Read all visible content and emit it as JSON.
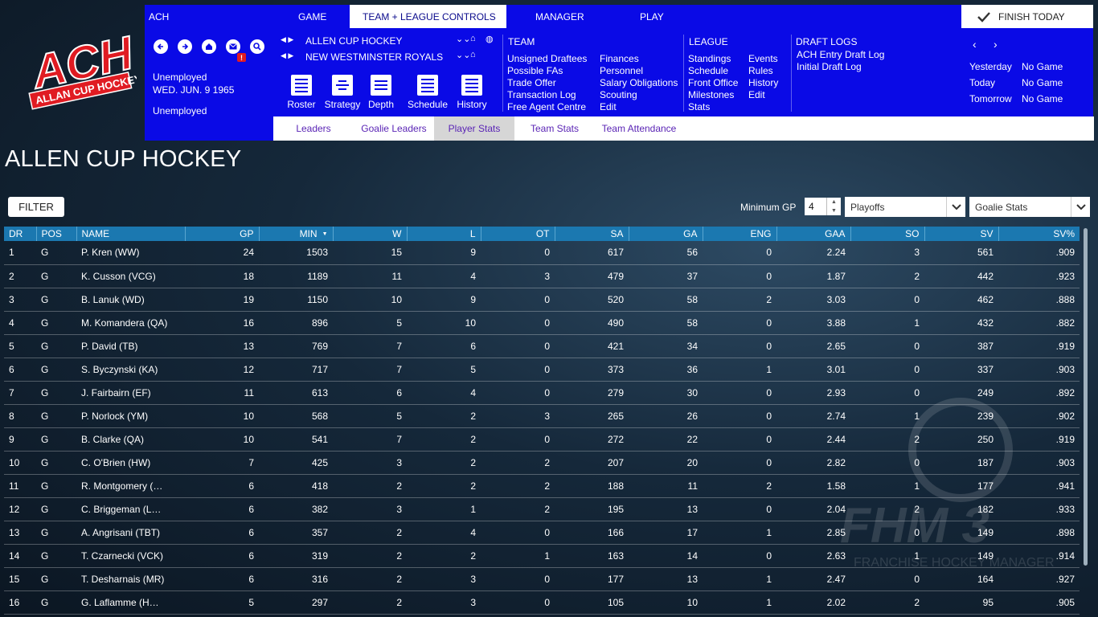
{
  "logo": {
    "main": "ACH",
    "sub": "ALLAN CUP HOCKEY"
  },
  "topnav": {
    "league_abbr": "ACH",
    "tabs": [
      "GAME",
      "TEAM + LEAGUE CONTROLS",
      "MANAGER",
      "PLAY"
    ],
    "finish": "FINISH TODAY"
  },
  "panel": {
    "status1": "Unemployed",
    "date": "WED. JUN. 9 1965",
    "status2": "Unemployed",
    "league_name": "ALLEN CUP HOCKEY",
    "team_name": "NEW WESTMINSTER ROYALS",
    "tools": [
      "Roster",
      "Strategy",
      "Depth",
      "Schedule",
      "History"
    ],
    "team_header": "TEAM",
    "team_col1": [
      "Unsigned Draftees",
      "Possible FAs",
      "Trade Offer",
      "Transaction Log",
      "Free Agent Centre"
    ],
    "team_col2": [
      "Finances",
      "Personnel",
      "Salary Obligations",
      "Scouting",
      "Edit"
    ],
    "league_header": "LEAGUE",
    "league_col1": [
      "Standings",
      "Schedule",
      "Front Office",
      "Milestones",
      "Stats"
    ],
    "league_col2": [
      "Events",
      "Rules",
      "History",
      "Edit"
    ],
    "draft_header": "DRAFT LOGS",
    "draft_links": [
      "ACH Entry Draft Log",
      "Initial Draft Log"
    ]
  },
  "days": [
    {
      "label": "Yesterday",
      "value": "No Game"
    },
    {
      "label": "Today",
      "value": "No Game"
    },
    {
      "label": "Tomorrow",
      "value": "No Game"
    }
  ],
  "subtabs": [
    "Leaders",
    "Goalie Leaders",
    "Player Stats",
    "Team Stats",
    "Team Attendance"
  ],
  "page_title": "ALLEN CUP HOCKEY",
  "filter": {
    "button": "FILTER",
    "min_gp_label": "Minimum GP",
    "min_gp": "4",
    "season_type": "Playoffs",
    "stat_type": "Goalie Stats"
  },
  "table": {
    "columns": [
      "DR",
      "POS",
      "NAME",
      "GP",
      "MIN",
      "W",
      "L",
      "OT",
      "SA",
      "GA",
      "ENG",
      "GAA",
      "SO",
      "SV",
      "SV%"
    ],
    "rows": [
      [
        "1",
        "G",
        "P. Kren  (WW)",
        "24",
        "1503",
        "15",
        "9",
        "0",
        "617",
        "56",
        "0",
        "2.24",
        "3",
        "561",
        ".909"
      ],
      [
        "2",
        "G",
        "K. Cusson  (VCG)",
        "18",
        "1189",
        "11",
        "4",
        "3",
        "479",
        "37",
        "0",
        "1.87",
        "2",
        "442",
        ".923"
      ],
      [
        "3",
        "G",
        "B. Lanuk  (WD)",
        "19",
        "1150",
        "10",
        "9",
        "0",
        "520",
        "58",
        "2",
        "3.03",
        "0",
        "462",
        ".888"
      ],
      [
        "4",
        "G",
        "M. Komandera  (QA)",
        "16",
        "896",
        "5",
        "10",
        "0",
        "490",
        "58",
        "0",
        "3.88",
        "1",
        "432",
        ".882"
      ],
      [
        "5",
        "G",
        "P. David  (TB)",
        "13",
        "769",
        "7",
        "6",
        "0",
        "421",
        "34",
        "0",
        "2.65",
        "0",
        "387",
        ".919"
      ],
      [
        "6",
        "G",
        "S. Byczynski  (KA)",
        "12",
        "717",
        "7",
        "5",
        "0",
        "373",
        "36",
        "1",
        "3.01",
        "0",
        "337",
        ".903"
      ],
      [
        "7",
        "G",
        "J. Fairbairn  (EF)",
        "11",
        "613",
        "6",
        "4",
        "0",
        "279",
        "30",
        "0",
        "2.93",
        "0",
        "249",
        ".892"
      ],
      [
        "8",
        "G",
        "P. Norlock  (YM)",
        "10",
        "568",
        "5",
        "2",
        "3",
        "265",
        "26",
        "0",
        "2.74",
        "1",
        "239",
        ".902"
      ],
      [
        "9",
        "G",
        "B. Clarke  (QA)",
        "10",
        "541",
        "7",
        "2",
        "0",
        "272",
        "22",
        "0",
        "2.44",
        "2",
        "250",
        ".919"
      ],
      [
        "10",
        "G",
        "C. O'Brien  (HW)",
        "7",
        "425",
        "3",
        "2",
        "2",
        "207",
        "20",
        "0",
        "2.82",
        "0",
        "187",
        ".903"
      ],
      [
        "11",
        "G",
        "R. Montgomery  (…",
        "6",
        "418",
        "2",
        "2",
        "2",
        "188",
        "11",
        "2",
        "1.58",
        "1",
        "177",
        ".941"
      ],
      [
        "12",
        "G",
        "C. Briggeman  (L…",
        "6",
        "382",
        "3",
        "1",
        "2",
        "195",
        "13",
        "0",
        "2.04",
        "2",
        "182",
        ".933"
      ],
      [
        "13",
        "G",
        "A. Angrisani  (TBT)",
        "6",
        "357",
        "2",
        "4",
        "0",
        "166",
        "17",
        "1",
        "2.85",
        "0",
        "149",
        ".898"
      ],
      [
        "14",
        "G",
        "T. Czarnecki  (VCK)",
        "6",
        "319",
        "2",
        "2",
        "1",
        "163",
        "14",
        "0",
        "2.63",
        "1",
        "149",
        ".914"
      ],
      [
        "15",
        "G",
        "T. Desharnais  (MR)",
        "6",
        "316",
        "2",
        "3",
        "0",
        "177",
        "13",
        "1",
        "2.47",
        "0",
        "164",
        ".927"
      ],
      [
        "16",
        "G",
        "G. Laflamme  (H…",
        "5",
        "297",
        "2",
        "3",
        "0",
        "105",
        "10",
        "1",
        "2.02",
        "2",
        "95",
        ".905"
      ]
    ]
  },
  "watermark": {
    "title": "FHM 3",
    "subtitle": "FRANCHISE HOCKEY MANAGER"
  }
}
